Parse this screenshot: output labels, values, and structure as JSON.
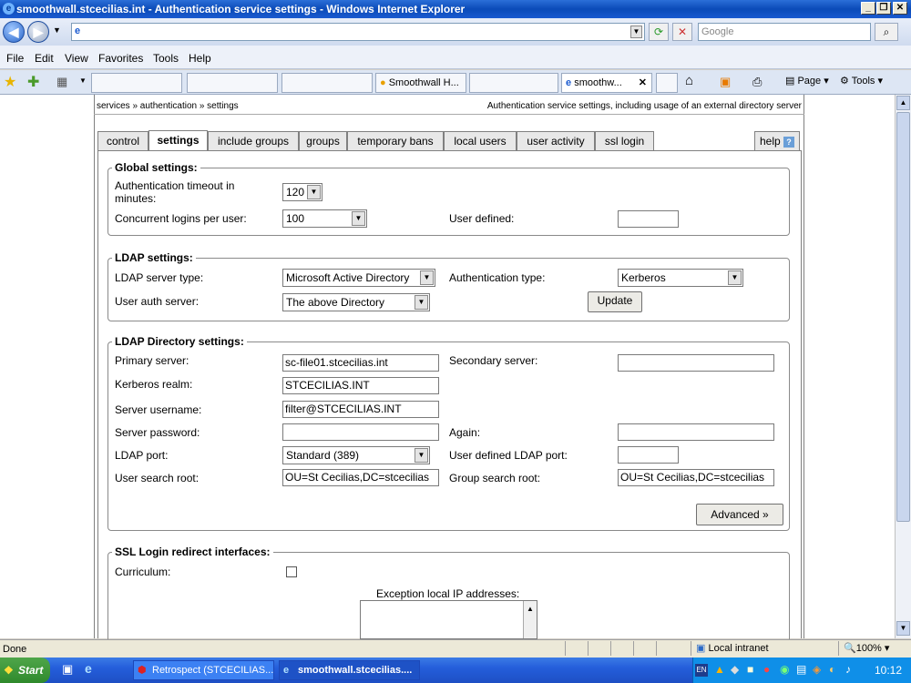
{
  "window": {
    "title": "smoothwall.stcecilias.int - Authentication service settings - Windows Internet Explorer",
    "search_placeholder": "Google"
  },
  "menu": [
    "File",
    "Edit",
    "View",
    "Favorites",
    "Tools",
    "Help"
  ],
  "browser_tabs": [
    "Smoothwall H...",
    "smoothw..."
  ],
  "toolbar": {
    "page": "Page",
    "tools": "Tools"
  },
  "breadcrumb": {
    "path": "services » authentication » settings",
    "description": "Authentication service settings, including usage of an external directory server"
  },
  "page_tabs": [
    "control",
    "settings",
    "include groups",
    "groups",
    "temporary bans",
    "local users",
    "user activity",
    "ssl login"
  ],
  "help_label": "help",
  "global": {
    "legend": "Global settings:",
    "timeout_label": "Authentication timeout in minutes:",
    "timeout_value": "120",
    "concurrent_label": "Concurrent logins per user:",
    "concurrent_value": "100",
    "user_defined_label": "User defined:"
  },
  "ldap": {
    "legend": "LDAP settings:",
    "server_type_label": "LDAP server type:",
    "server_type_value": "Microsoft Active Directory",
    "auth_type_label": "Authentication type:",
    "auth_type_value": "Kerberos",
    "user_auth_label": "User auth server:",
    "user_auth_value": "The above Directory",
    "update_label": "Update"
  },
  "directory": {
    "legend": "LDAP Directory settings:",
    "primary_label": "Primary server:",
    "primary_value": "sc-file01.stcecilias.int",
    "secondary_label": "Secondary server:",
    "realm_label": "Kerberos realm:",
    "realm_value": "STCECILIAS.INT",
    "username_label": "Server username:",
    "username_value": "filter@STCECILIAS.INT",
    "password_label": "Server password:",
    "again_label": "Again:",
    "port_label": "LDAP port:",
    "port_value": "Standard (389)",
    "user_port_label": "User defined LDAP port:",
    "user_root_label": "User search root:",
    "user_root_value": "OU=St Cecilias,DC=stcecilias",
    "group_root_label": "Group search root:",
    "group_root_value": "OU=St Cecilias,DC=stcecilias",
    "advanced_label": "Advanced »"
  },
  "ssl": {
    "legend": "SSL Login redirect interfaces:",
    "curriculum_label": "Curriculum:",
    "exception_label": "Exception local IP addresses:"
  },
  "status": {
    "left": "Done",
    "zone": "Local intranet",
    "zoom": "100%"
  },
  "taskbar": {
    "start": "Start",
    "items": [
      "Retrospect (STCECILIAS...",
      "smoothwall.stcecilias...."
    ],
    "lang": "EN",
    "clock": "10:12"
  }
}
